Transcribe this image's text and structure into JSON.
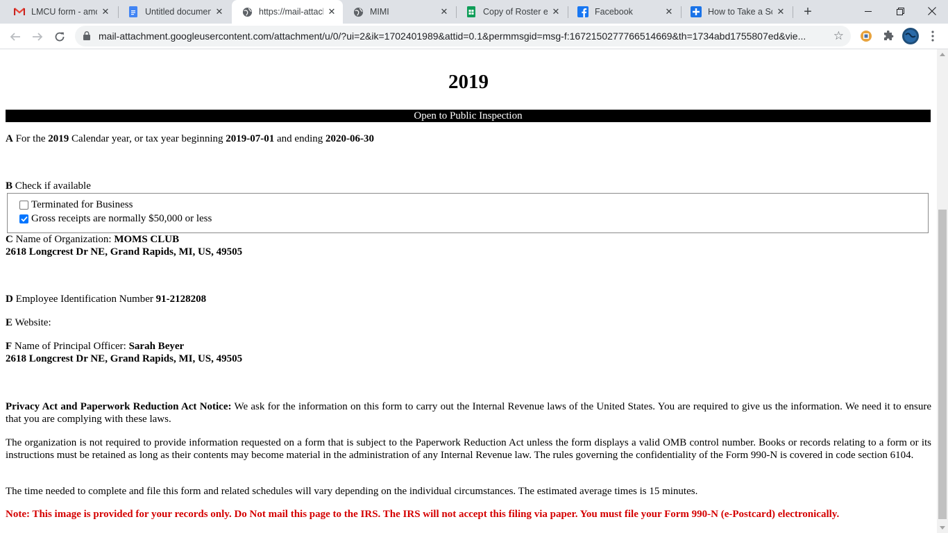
{
  "browser": {
    "tabs": [
      {
        "title": "LMCU form - amo",
        "icon": "gmail-icon"
      },
      {
        "title": "Untitled document",
        "icon": "google-docs-icon"
      },
      {
        "title": "https://mail-attach",
        "icon": "globe-icon"
      },
      {
        "title": "MIMI",
        "icon": "globe-icon"
      },
      {
        "title": "Copy of Roster en",
        "icon": "google-sheets-icon"
      },
      {
        "title": "Facebook",
        "icon": "facebook-icon"
      },
      {
        "title": "How to Take a Scre",
        "icon": "site-icon"
      }
    ],
    "active_tab_index": 2,
    "url": "mail-attachment.googleusercontent.com/attachment/u/0/?ui=2&ik=1702401989&attid=0.1&permmsgid=msg-f:1672150277766514669&th=1734abd1755807ed&vie..."
  },
  "document": {
    "year": "2019",
    "banner": "Open to Public Inspection",
    "section_a": {
      "letter": "A",
      "text1": "For the",
      "year": "2019",
      "text2": "Calendar year, or tax year beginning",
      "begin": "2019-07-01",
      "text3": "and ending",
      "end": "2020-06-30"
    },
    "section_b": {
      "letter": "B",
      "label": "Check if available",
      "options": [
        {
          "label": "Terminated for Business",
          "checked": false
        },
        {
          "label": "Gross receipts are normally $50,000 or less",
          "checked": true
        }
      ]
    },
    "section_c": {
      "letter": "C",
      "label": "Name of Organization:",
      "name": "MOMS CLUB",
      "address": "2618 Longcrest Dr NE, Grand Rapids, MI, US, 49505"
    },
    "section_d": {
      "letter": "D",
      "label": "Employee Identification Number",
      "value": "91-2128208"
    },
    "section_e": {
      "letter": "E",
      "label": "Website:"
    },
    "section_f": {
      "letter": "F",
      "label": "Name of Principal Officer:",
      "name": "Sarah Beyer",
      "address": "2618 Longcrest Dr NE, Grand Rapids, MI, US, 49505"
    },
    "privacy_heading": "Privacy Act and Paperwork Reduction Act Notice:",
    "privacy_text": "We ask for the information on this form to carry out the Internal Revenue laws of the United States. You are required to give us the information. We need it to ensure that you are complying with these laws.",
    "paperwork_text": "The organization is not required to provide information requested on a form that is subject to the Paperwork Reduction Act unless the form displays a valid OMB control number. Books or records relating to a form or its instructions must be retained as long as their contents may become material in the administration of any Internal Revenue law. The rules governing the confidentiality of the Form 990-N is covered in code section 6104.",
    "time_text": "The time needed to complete and file this form and related schedules will vary depending on the individual circumstances. The estimated average times is 15 minutes.",
    "note": "Note: This image is provided for your records only. Do Not mail this page to the IRS. The IRS will not accept this filing via paper. You must file your Form 990-N (e-Postcard) electronically."
  },
  "colors": {
    "note_red": "#d40000",
    "checkbox_blue": "#0075ff",
    "tabstrip": "#dee1e6"
  }
}
